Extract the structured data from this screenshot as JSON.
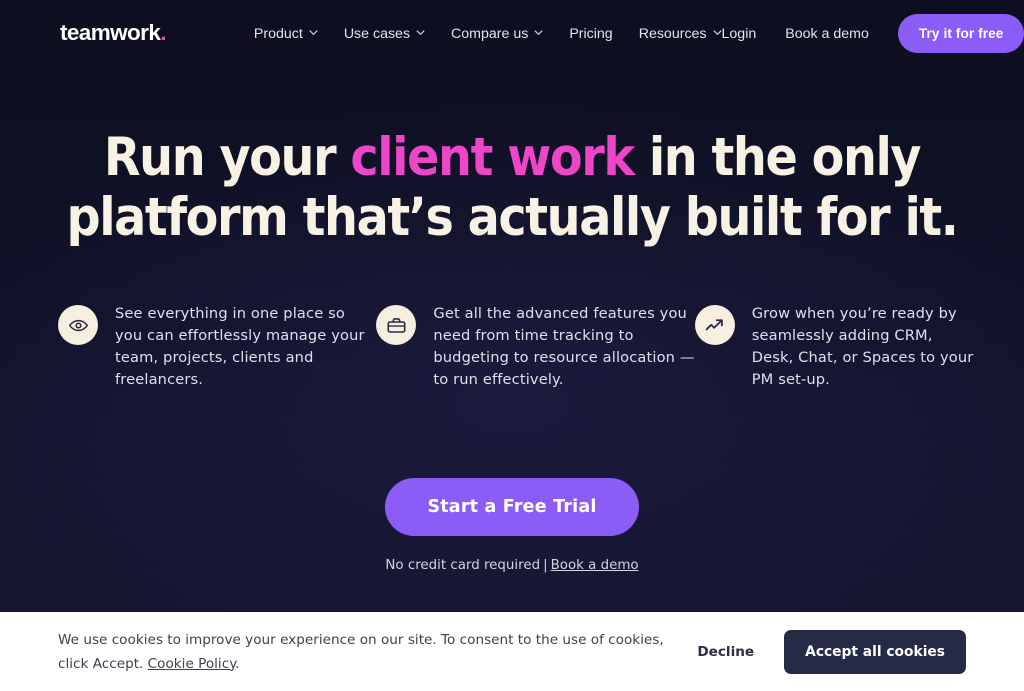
{
  "colors": {
    "background": "#0e0f21",
    "accent_pink": "#ee46c8",
    "accent_purple": "#8b5cf6",
    "cream": "#f6efdf",
    "headline": "#f8f2e4",
    "banner_button": "#252a47"
  },
  "navbar": {
    "logo": "teamwork",
    "logo_dot": ".",
    "menu": [
      {
        "label": "Product",
        "has_chevron": true,
        "icon": "chevron-down-icon"
      },
      {
        "label": "Use cases",
        "has_chevron": true,
        "icon": "chevron-down-icon"
      },
      {
        "label": "Compare us",
        "has_chevron": true,
        "icon": "chevron-down-icon"
      },
      {
        "label": "Pricing",
        "has_chevron": false,
        "icon": ""
      },
      {
        "label": "Resources",
        "has_chevron": true,
        "icon": "chevron-down-icon"
      }
    ],
    "login_label": "Login",
    "book_demo_label": "Book a demo",
    "try_free_label": "Try it for free"
  },
  "hero": {
    "headline_part1": "Run your ",
    "headline_accent": "client work",
    "headline_part2": " in the only platform that’s actually built for it."
  },
  "features": [
    {
      "icon": "eye-icon",
      "text": "See everything in one place so you can effortlessly manage your team, projects, clients and freelancers."
    },
    {
      "icon": "briefcase-icon",
      "text": "Get all the advanced features you need from time tracking to budgeting to resource allocation — to run effectively."
    },
    {
      "icon": "trending-up-icon",
      "text": "Grow when you’re ready by seamlessly adding CRM, Desk, Chat, or Spaces to your PM set-up."
    }
  ],
  "cta": {
    "button_label": "Start a Free Trial",
    "subtext": "No credit card required",
    "separator": "|",
    "demo_link": "Book a demo"
  },
  "cookie_banner": {
    "text_before_link": "We use cookies to improve your experience on our site. To consent to the use of cookies, click Accept. ",
    "policy_link": "Cookie Policy",
    "text_after_link": ".",
    "decline_label": "Decline",
    "accept_label": "Accept all cookies"
  }
}
